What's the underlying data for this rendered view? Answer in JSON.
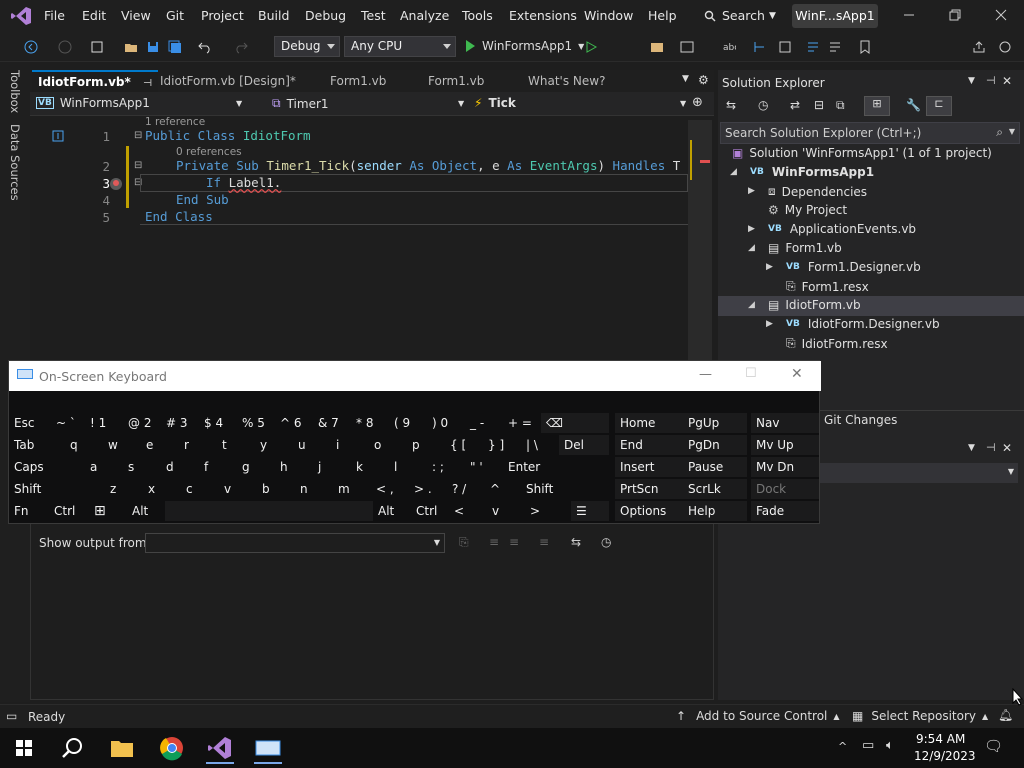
{
  "menubar": {
    "items": [
      "File",
      "Edit",
      "View",
      "Git",
      "Project",
      "Build",
      "Debug",
      "Test",
      "Analyze",
      "Tools",
      "Extensions",
      "Window",
      "Help"
    ],
    "search": "Search",
    "solution_name": "WinF...sApp1"
  },
  "toolbar": {
    "config": "Debug",
    "platform": "Any CPU",
    "start_target": "WinFormsApp1"
  },
  "side_tabs": [
    "Toolbox",
    "Data Sources"
  ],
  "doc_tabs": [
    {
      "label": "IdiotForm.vb*",
      "active": true
    },
    {
      "label": "IdiotForm.vb [Design]*",
      "active": false
    },
    {
      "label": "Form1.vb",
      "active": false
    },
    {
      "label": "Form1.vb",
      "active": false
    },
    {
      "label": "What's New?",
      "active": false
    }
  ],
  "navbar": {
    "project": "WinFormsApp1",
    "object": "Timer1",
    "member": "Tick"
  },
  "editor": {
    "refs": [
      "1 reference",
      "0 references"
    ],
    "line_numbers": [
      "1",
      "2",
      "3",
      "4",
      "5"
    ],
    "lines": [
      {
        "parts": [
          [
            "kw",
            "Public Class "
          ],
          [
            "ty",
            "IdiotForm"
          ]
        ]
      },
      {
        "parts": [
          [
            "kw",
            "Private Sub "
          ],
          [
            "id",
            "Timer1_Tick"
          ],
          [
            "pl",
            "("
          ],
          [
            "pl",
            "sender "
          ],
          [
            "kw",
            "As "
          ],
          [
            "kw",
            "Object"
          ],
          [
            "pl",
            ", e "
          ],
          [
            "kw",
            "As "
          ],
          [
            "ty",
            "EventArgs"
          ],
          [
            "pl",
            ") "
          ],
          [
            "kw",
            "Handles "
          ],
          [
            "pl",
            "T"
          ]
        ]
      },
      {
        "parts": [
          [
            "kw",
            "If "
          ],
          [
            "pl",
            "Label1."
          ]
        ]
      },
      {
        "parts": [
          [
            "kw",
            "End Sub"
          ]
        ]
      },
      {
        "parts": [
          [
            "kw",
            "End Class"
          ]
        ]
      }
    ]
  },
  "solution_explorer": {
    "title": "Solution Explorer",
    "search_placeholder": "Search Solution Explorer (Ctrl+;)",
    "items": [
      {
        "label": "Solution 'WinFormsApp1' (1 of 1 project)",
        "bold": false
      },
      {
        "label": "WinFormsApp1",
        "bold": true
      },
      {
        "label": "Dependencies",
        "bold": false
      },
      {
        "label": "My Project",
        "bold": false
      },
      {
        "label": "ApplicationEvents.vb",
        "bold": false
      },
      {
        "label": "Form1.vb",
        "bold": false
      },
      {
        "label": "Form1.Designer.vb",
        "bold": false
      },
      {
        "label": "Form1.resx",
        "bold": false
      },
      {
        "label": "IdiotForm.vb",
        "bold": false
      },
      {
        "label": "IdiotForm.Designer.vb",
        "bold": false
      },
      {
        "label": "IdiotForm.resx",
        "bold": false
      }
    ]
  },
  "git_panel": {
    "tab": "Git Changes"
  },
  "output": {
    "label": "Show output from:"
  },
  "osk": {
    "title": "On-Screen Keyboard",
    "rows": [
      [
        "Esc",
        "~ `",
        "! 1",
        "@ 2",
        "# 3",
        "$ 4",
        "% 5",
        "^ 6",
        "& 7",
        "* 8",
        "( 9",
        ") 0",
        "_ -",
        "+ =",
        "⌫"
      ],
      [
        "Tab",
        "q",
        "w",
        "e",
        "r",
        "t",
        "y",
        "u",
        "i",
        "o",
        "p",
        "{ [",
        "} ]",
        "| \\",
        "Del"
      ],
      [
        "Caps",
        "a",
        "s",
        "d",
        "f",
        "g",
        "h",
        "j",
        "k",
        "l",
        ": ;",
        "\" '",
        "Enter"
      ],
      [
        "Shift",
        "z",
        "x",
        "c",
        "v",
        "b",
        "n",
        "m",
        "< ,",
        "> .",
        "? /",
        "^",
        "Shift"
      ],
      [
        "Fn",
        "Ctrl",
        "⊞",
        "Alt",
        "",
        "Alt",
        "Ctrl",
        "<",
        "v",
        ">",
        "☰"
      ]
    ],
    "nav_cols": [
      [
        "Home",
        "End",
        "Insert",
        "PrtScn",
        "Options"
      ],
      [
        "PgUp",
        "PgDn",
        "Pause",
        "ScrLk",
        "Help"
      ],
      [
        "Nav",
        "Mv Up",
        "Mv Dn",
        "Dock",
        "Fade"
      ]
    ]
  },
  "status": {
    "ready": "Ready",
    "source_control": "Add to Source Control",
    "repo": "Select Repository"
  },
  "taskbar": {
    "time": "9:54 AM",
    "date": "12/9/2023"
  }
}
